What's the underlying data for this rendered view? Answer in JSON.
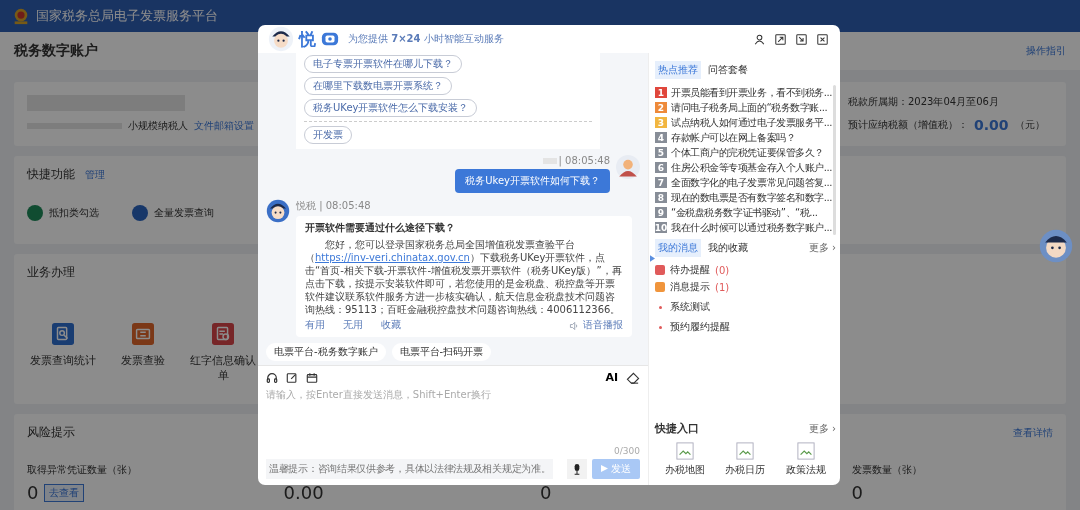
{
  "app_header": {
    "title": "国家税务总局电子发票服务平台"
  },
  "page": {
    "title": "税务数字账户",
    "guide_link": "操作指引"
  },
  "account_card": {
    "taxpayer_type": "小规模纳税人",
    "email_link": "文件邮箱设置",
    "period": "税款所属期：2023年04月至06月",
    "estimate_label": "预计应纳税额（增值税）：",
    "estimate_value": "0.00",
    "estimate_unit": "（元）"
  },
  "quick_functions": {
    "title": "快捷功能",
    "manage_link": "管理",
    "items": [
      {
        "label": "抵扣类勾选"
      },
      {
        "label": "全量发票查询"
      }
    ]
  },
  "business": {
    "title": "业务办理",
    "tiles": [
      {
        "label": "发票查询统计",
        "kind": "search"
      },
      {
        "label": "发票查验",
        "kind": "ticket"
      },
      {
        "label": "红字信息确认单",
        "kind": "confirm"
      }
    ]
  },
  "risk": {
    "title": "风险提示",
    "details_link": "查看详情",
    "metrics": [
      {
        "label": "取得异常凭证数量（张）",
        "value": "0",
        "action": "去查看"
      },
      {
        "value": "0.00"
      },
      {
        "value": "0"
      },
      {
        "label": "发票数量（张）",
        "value": "0"
      }
    ]
  },
  "chat": {
    "header": {
      "brand": "悦",
      "tagline": "为您提供 **7×24** 小时智能互动服务"
    },
    "suggestion_card": {
      "questions": [
        "电子专票开票软件在哪儿下载？",
        "在哪里下载数电票开票系统？",
        "税务UKey开票软件怎么下载安装？"
      ],
      "action": "开发票"
    },
    "user_message": {
      "time": "| 08:05:48",
      "text": "税务Ukey开票软件如何下载？"
    },
    "bot_message": {
      "meta": "悦税 | 08:05:48",
      "title": "开票软件需要通过什么途径下载？",
      "text_before": "您好，您可以登录国家税务总局全国增值税发票查验平台（",
      "link": "https://inv-veri.chinatax.gov.cn",
      "text_after": "）下载税务UKey开票软件，点击“首页-相关下载-开票软件-增值税发票开票软件（税务UKey版）”，再点击下载，按提示安装软件即可，若您使用的是金税盘、税控盘等开票软件建议联系软件服务方进一步核实确认，航天信息金税盘技术问题咨询热线：95113；百旺金融税控盘技术问题咨询热线：4006112366。",
      "feedback": [
        "有用",
        "无用",
        "收藏"
      ],
      "speak": "语音播报"
    },
    "shortcut_chips": [
      "电票平台-税务数字账户",
      "电票平台-扫码开票"
    ],
    "composer": {
      "ai_label": "AI",
      "placeholder": "请输入，按Enter直接发送消息，Shift+Enter换行",
      "counter": "0/300",
      "notice": "温馨提示：咨询结果仅供参考，具体以法律法规及相关规定为准。",
      "send": "发送",
      "send_disabled": true
    }
  },
  "side_panel": {
    "hot_tabs": [
      {
        "label": "热点推荐",
        "selected": true
      },
      {
        "label": "问答套餐",
        "selected": false
      }
    ],
    "hot_questions": [
      {
        "rank": "1",
        "text": "开票员能看到开票业务，看不到税务...",
        "color": "#e0473c"
      },
      {
        "rank": "2",
        "text": "请问电子税务局上面的“税务数字账...",
        "color": "#ee8a3a"
      },
      {
        "rank": "3",
        "text": "试点纳税人如何通过电子发票服务平...",
        "color": "#f2b640"
      },
      {
        "rank": "4",
        "text": "存款帐户可以在网上备案吗？",
        "color": "#878d97"
      },
      {
        "rank": "5",
        "text": "个体工商户的完税凭证要保管多久？",
        "color": "#878d97"
      },
      {
        "rank": "6",
        "text": "住房公积金等专项基金存入个人账户...",
        "color": "#878d97"
      },
      {
        "rank": "7",
        "text": "全面数字化的电子发票常见问题答复...",
        "color": "#878d97"
      },
      {
        "rank": "8",
        "text": "现在的数电票是否有数字签名和数字...",
        "color": "#878d97"
      },
      {
        "rank": "9",
        "text": "“金税盘税务数字证书驱动”、“税...",
        "color": "#878d97"
      },
      {
        "rank": "10",
        "text": "我在什么时候可以通过税务数字账户...",
        "color": "#878d97"
      }
    ],
    "message_tabs": [
      {
        "label": "我的消息",
        "selected": true
      },
      {
        "label": "我的收藏",
        "selected": false
      }
    ],
    "messages_more": "更多 ›",
    "messages": [
      {
        "kind": "counter",
        "label": "待办提醒",
        "count": "(0)",
        "color": "#e05a5a"
      },
      {
        "kind": "counter",
        "label": "消息提示",
        "count": "(1)",
        "color": "#f0953c"
      },
      {
        "kind": "bullet",
        "label": "系统测试"
      },
      {
        "kind": "bullet",
        "label": "预约履约提醒"
      }
    ],
    "quick_entry": {
      "title": "快捷入口",
      "more": "更多 ›",
      "items": [
        {
          "label": "办税地图"
        },
        {
          "label": "办税日历"
        },
        {
          "label": "政策法规"
        }
      ]
    }
  }
}
